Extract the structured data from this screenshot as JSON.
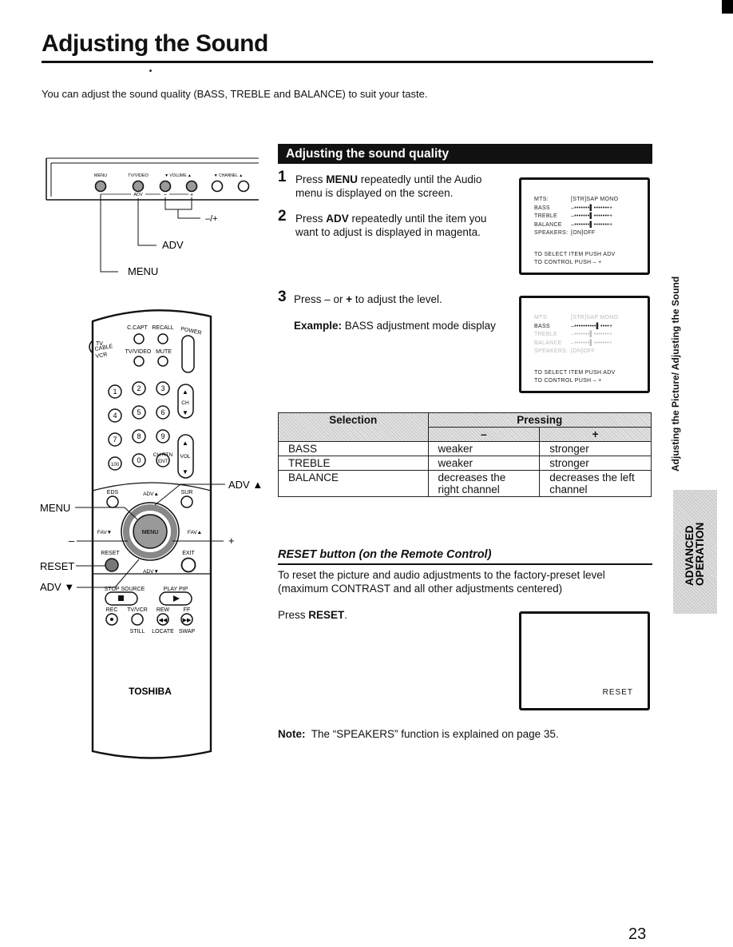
{
  "page": {
    "title": "Adjusting the Sound",
    "intro": "You can adjust the sound quality (BASS, TREBLE and BALANCE) to suit your taste.",
    "page_number": "23"
  },
  "side_tab": {
    "running_title": "Adjusting the Picture/ Adjusting the Sound",
    "section_line1": "ADVANCED",
    "section_line2": "OPERATION"
  },
  "tv_panel": {
    "button_labels": [
      "MENU",
      "TV/VIDEO",
      "▼ VOLUME ▲",
      "▼ CHANNEL ▲"
    ],
    "sub_labels": {
      "adv": "ADV",
      "minus": "–",
      "plus": "+"
    },
    "callouts": {
      "minus_plus": "–/+",
      "adv": "ADV",
      "menu": "MENU"
    }
  },
  "remote": {
    "top_labels": {
      "ccapt": "C.CAPT",
      "recall": "RECALL",
      "power": "POWER",
      "tvvideo": "TV/VIDEO",
      "mute": "MUTE",
      "tv": "TV",
      "cable": "CABLE",
      "vcr": "VCR"
    },
    "digits": [
      "1",
      "2",
      "3",
      "4",
      "5",
      "6",
      "7",
      "8",
      "9",
      "100",
      "0",
      "ENT"
    ],
    "ch_label": "CH",
    "vol_label": "VOL",
    "chrtn_label": "CH RTN",
    "nav_labels": {
      "eds": "EDS",
      "adv_up": "ADV▲",
      "sur": "SUR",
      "fav_down": "FAV▼",
      "menu": "MENU",
      "fav_up": "FAV▲",
      "reset": "RESET",
      "exit": "EXIT",
      "adv_down": "ADV▼"
    },
    "bottom_labels": {
      "stop_source": "STOP SOURCE",
      "play_pip": "PLAY PIP",
      "rec": "REC",
      "tvvcr": "TV/VCR",
      "rew": "REW",
      "ff": "FF",
      "still": "STILL",
      "locate": "LOCATE",
      "swap": "SWAP"
    },
    "brand": "TOSHIBA",
    "callouts": {
      "adv_up": "ADV ▲",
      "menu": "MENU",
      "minus": "–",
      "plus": "+",
      "reset": "RESET",
      "adv_down": "ADV ▼"
    }
  },
  "section": {
    "heading": "Adjusting the sound quality",
    "steps": [
      {
        "num": "1",
        "pre": "Press ",
        "bold": "MENU",
        "post": " repeatedly until the Audio menu is displayed on the screen."
      },
      {
        "num": "2",
        "pre": "Press ",
        "bold": "ADV",
        "post": " repeatedly until the item you want to adjust is displayed in magenta."
      },
      {
        "num": "3",
        "pre": "Press – or ",
        "bold": "+",
        "post": " to adjust the level."
      }
    ],
    "example_label": "Example:",
    "example_text": " BASS adjustment mode display"
  },
  "audio_menu_screen": {
    "rows": [
      {
        "label": "MTS:",
        "value": "[STR]SAP  MONO"
      },
      {
        "label": "BASS",
        "value": "–•••••••▌•••••••+"
      },
      {
        "label": "TREBLE",
        "value": "–•••••••▌•••••••+"
      },
      {
        "label": "BALANCE",
        "value": "–•••••••▌•••••••+"
      },
      {
        "label": "SPEAKERS:",
        "value": "[ON]OFF"
      }
    ],
    "hint1": "TO SELECT  ITEM PUSH ADV",
    "hint2": "TO CONTROL  PUSH  –  +"
  },
  "bass_screen": {
    "rows": [
      {
        "label": "MTS:",
        "value": "[STR]SAP  MONO",
        "active": false
      },
      {
        "label": "BASS",
        "value": "–••••••••••▌••••+",
        "active": true
      },
      {
        "label": "TREBLE",
        "value": "–•••••••▌•••••••+",
        "active": false
      },
      {
        "label": "BALANCE",
        "value": "–•••••••▌•••••••+",
        "active": false
      },
      {
        "label": "SPEAKERS:",
        "value": "[ON]OFF",
        "active": false
      }
    ],
    "hint1": "TO SELECT  ITEM PUSH ADV",
    "hint2": "TO CONTROL  PUSH  –  +"
  },
  "table": {
    "header_selection": "Selection",
    "header_pressing": "Pressing",
    "header_minus": "–",
    "header_plus": "+",
    "rows": [
      {
        "selection": "BASS",
        "minus": "weaker",
        "plus": "stronger"
      },
      {
        "selection": "TREBLE",
        "minus": "weaker",
        "plus": "stronger"
      },
      {
        "selection": "BALANCE",
        "minus": "decreases the right channel",
        "plus": "decreases the left channel"
      }
    ]
  },
  "reset": {
    "heading": "RESET button (on the Remote Control)",
    "text": "To reset the picture and audio adjustments to the factory-preset level (maximum CONTRAST and all other adjustments centered)",
    "press_pre": "Press ",
    "press_bold": "RESET",
    "press_post": ".",
    "screen_text": "RESET"
  },
  "note": {
    "label": "Note:",
    "text": "  The “SPEAKERS” function is explained on page 35."
  }
}
